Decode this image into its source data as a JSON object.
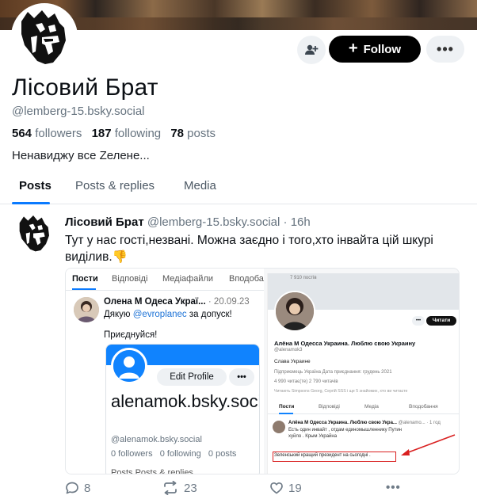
{
  "profile": {
    "display_name": "Лісовий Брат",
    "handle": "@lemberg-15.bsky.social",
    "followers_count": "564",
    "followers_label": "followers",
    "following_count": "187",
    "following_label": "following",
    "posts_count": "78",
    "posts_label": "posts",
    "bio": "Ненавиджу все Zелене..."
  },
  "header": {
    "follow_label": "Follow",
    "more_label": "•••"
  },
  "tabs": [
    {
      "label": "Posts",
      "active": true
    },
    {
      "label": "Posts & replies",
      "active": false
    },
    {
      "label": "Media",
      "active": false
    }
  ],
  "post": {
    "author_name": "Лісовий Брат",
    "author_handle": "@lemberg-15.bsky.social",
    "time": "· 16h",
    "text": "Тут у нас гості,незвані. Можна заєдно і того,хто інвайта цій шкурі виділив.👎",
    "replies": "8",
    "reposts": "23",
    "likes": "19"
  },
  "embedded_left": {
    "tabs": [
      "Пости",
      "Відповіді",
      "Медіафайли",
      "Вподоба"
    ],
    "author_name": "Олена М Одеса Украї...",
    "time": "· 20.09.23",
    "line_prefix": "Дякую ",
    "mention": "@evroplanec",
    "line_suffix": " за допуск!",
    "join_text": "Приєднуйся!",
    "edit_profile": "Edit Profile",
    "dots": "•••",
    "card_name": "alenamok.bsky.social",
    "card_handle": "@alenamok.bsky.social",
    "card_followers": "0 followers",
    "card_following": "0 following",
    "card_posts": "0 posts",
    "card_tabs": "Posts   Posts & replies"
  },
  "embedded_right": {
    "posts_count": "7 910 постів",
    "dots": "•••",
    "read_btn": "Читати",
    "name": "Алёна М Одесса Украина. Люблю свою Украину",
    "handle": "@alenamok3",
    "bio": "Слава Украине",
    "meta": "Підприємець   Україна   Дата приєднання: грудень 2021",
    "stats": "4 990 читає(те)   2 790 читачів",
    "follows": "Читають Simpsons Georg, Сергій SSS і ще 5 знайомих, хто ви читаєте",
    "tabs": [
      "Пости",
      "Відповіді",
      "Медіа",
      "Вподобання"
    ],
    "post_name": "Алёна М Одесса Украина. Люблю свою Укра...",
    "post_meta": "@alenamo... · 1 год",
    "post_text": "Есть один инвайт , отдам единомышленнику Путин хуйло . Крым Украйна",
    "highlight_text": "Зеленський кращий президент на сьогодні ."
  },
  "colors": {
    "accent": "#0a7aff",
    "follow_bg": "#000000",
    "muted": "#66737f"
  },
  "icons": {
    "add_user": "add-user-icon",
    "reply": "reply-icon",
    "repost": "repost-icon",
    "like": "heart-icon"
  }
}
